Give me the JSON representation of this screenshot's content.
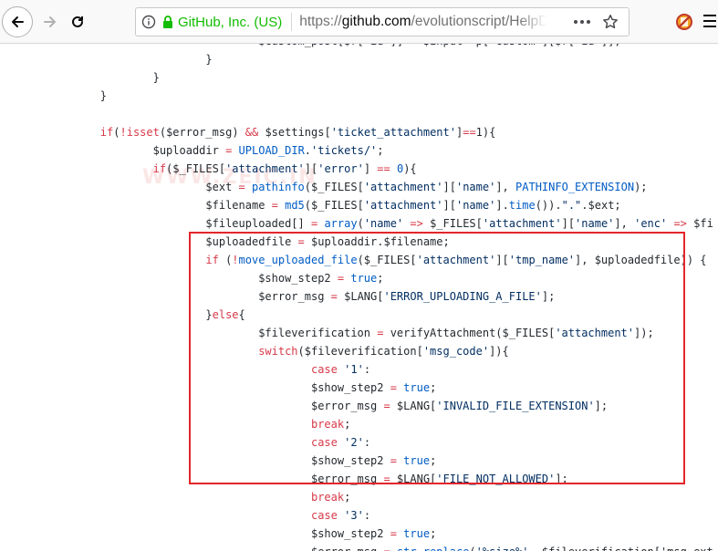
{
  "browser": {
    "identity_label": "GitHub, Inc. (US)",
    "url_prefix": "https://",
    "url_domain": "github.com",
    "url_path": "/evolutionscript/HelpDe",
    "icons": [
      "back-icon",
      "forward-icon",
      "reload-icon",
      "info-icon",
      "lock-icon",
      "page-actions-icon",
      "bookmark-star-icon",
      "addon-icon",
      "menu-icon"
    ]
  },
  "watermark": "WWW.ZEIC.IN",
  "code_lines": [
    [
      {
        "t": "                                "
      },
      {
        "t": "$custom_post[$r['id']] = $input->p['custom'][$r['id']];"
      }
    ],
    [
      {
        "t": "                        }"
      }
    ],
    [
      {
        "t": "                }"
      }
    ],
    [
      {
        "t": "        }"
      }
    ],
    [
      {
        "t": ""
      }
    ],
    [
      {
        "t": "        "
      },
      {
        "t": "if",
        "c": "k"
      },
      {
        "t": "("
      },
      {
        "t": "!",
        "c": "k"
      },
      {
        "t": "isset",
        "c": "k"
      },
      {
        "t": "($error_msg) "
      },
      {
        "t": "&&",
        "c": "k"
      },
      {
        "t": " $settings["
      },
      {
        "t": "'ticket_attachment'",
        "c": "s"
      },
      {
        "t": "]"
      },
      {
        "t": "==",
        "c": "k"
      },
      {
        "t": "1){"
      }
    ],
    [
      {
        "t": "                $uploaddir "
      },
      {
        "t": "=",
        "c": "k"
      },
      {
        "t": " "
      },
      {
        "t": "UPLOAD_DIR",
        "c": "f"
      },
      {
        "t": "."
      },
      {
        "t": "'tickets/'",
        "c": "s"
      },
      {
        "t": ";"
      }
    ],
    [
      {
        "t": "                "
      },
      {
        "t": "if",
        "c": "k"
      },
      {
        "t": "($_FILES["
      },
      {
        "t": "'attachment'",
        "c": "s"
      },
      {
        "t": "]["
      },
      {
        "t": "'error'",
        "c": "s"
      },
      {
        "t": "] "
      },
      {
        "t": "==",
        "c": "k"
      },
      {
        "t": " "
      },
      {
        "t": "0",
        "c": "f"
      },
      {
        "t": "){"
      }
    ],
    [
      {
        "t": "                        $ext "
      },
      {
        "t": "=",
        "c": "k"
      },
      {
        "t": " "
      },
      {
        "t": "pathinfo",
        "c": "f"
      },
      {
        "t": "($_FILES["
      },
      {
        "t": "'attachment'",
        "c": "s"
      },
      {
        "t": "]["
      },
      {
        "t": "'name'",
        "c": "s"
      },
      {
        "t": "], "
      },
      {
        "t": "PATHINFO_EXTENSION",
        "c": "f"
      },
      {
        "t": ");"
      }
    ],
    [
      {
        "t": "                        $filename "
      },
      {
        "t": "=",
        "c": "k"
      },
      {
        "t": " "
      },
      {
        "t": "md5",
        "c": "f"
      },
      {
        "t": "($_FILES["
      },
      {
        "t": "'attachment'",
        "c": "s"
      },
      {
        "t": "]["
      },
      {
        "t": "'name'",
        "c": "s"
      },
      {
        "t": "]."
      },
      {
        "t": "time",
        "c": "f"
      },
      {
        "t": "())."
      },
      {
        "t": "\".\"",
        "c": "s"
      },
      {
        "t": ".$ext;"
      }
    ],
    [
      {
        "t": "                        $fileuploaded[] "
      },
      {
        "t": "=",
        "c": "k"
      },
      {
        "t": " "
      },
      {
        "t": "array",
        "c": "f"
      },
      {
        "t": "("
      },
      {
        "t": "'name'",
        "c": "s"
      },
      {
        "t": " "
      },
      {
        "t": "=>",
        "c": "k"
      },
      {
        "t": " $_FILES["
      },
      {
        "t": "'attachment'",
        "c": "s"
      },
      {
        "t": "]["
      },
      {
        "t": "'name'",
        "c": "s"
      },
      {
        "t": "], "
      },
      {
        "t": "'enc'",
        "c": "s"
      },
      {
        "t": " "
      },
      {
        "t": "=>",
        "c": "k"
      },
      {
        "t": " $fi"
      }
    ],
    [
      {
        "t": "                        $uploadedfile "
      },
      {
        "t": "=",
        "c": "k"
      },
      {
        "t": " $uploaddir.$filename;"
      }
    ],
    [
      {
        "t": "                        "
      },
      {
        "t": "if",
        "c": "k"
      },
      {
        "t": " ("
      },
      {
        "t": "!",
        "c": "k"
      },
      {
        "t": "move_uploaded_file",
        "c": "f"
      },
      {
        "t": "($_FILES["
      },
      {
        "t": "'attachment'",
        "c": "s"
      },
      {
        "t": "]["
      },
      {
        "t": "'tmp_name'",
        "c": "s"
      },
      {
        "t": "], $uploadedfile)) {"
      }
    ],
    [
      {
        "t": "                                $show_step2 "
      },
      {
        "t": "=",
        "c": "k"
      },
      {
        "t": " "
      },
      {
        "t": "true",
        "c": "f"
      },
      {
        "t": ";"
      }
    ],
    [
      {
        "t": "                                $error_msg "
      },
      {
        "t": "=",
        "c": "k"
      },
      {
        "t": " $LANG["
      },
      {
        "t": "'ERROR_UPLOADING_A_FILE'",
        "c": "s"
      },
      {
        "t": "];"
      }
    ],
    [
      {
        "t": "                        }"
      },
      {
        "t": "else",
        "c": "k"
      },
      {
        "t": "{"
      }
    ],
    [
      {
        "t": "                                $fileverification "
      },
      {
        "t": "=",
        "c": "k"
      },
      {
        "t": " verifyAttachment($_FILES["
      },
      {
        "t": "'attachment'",
        "c": "s"
      },
      {
        "t": "]);"
      }
    ],
    [
      {
        "t": "                                "
      },
      {
        "t": "switch",
        "c": "k"
      },
      {
        "t": "($fileverification["
      },
      {
        "t": "'msg_code'",
        "c": "s"
      },
      {
        "t": "]){"
      }
    ],
    [
      {
        "t": "                                        "
      },
      {
        "t": "case",
        "c": "k"
      },
      {
        "t": " "
      },
      {
        "t": "'1'",
        "c": "s"
      },
      {
        "t": ":"
      }
    ],
    [
      {
        "t": "                                        $show_step2 "
      },
      {
        "t": "=",
        "c": "k"
      },
      {
        "t": " "
      },
      {
        "t": "true",
        "c": "f"
      },
      {
        "t": ";"
      }
    ],
    [
      {
        "t": "                                        $error_msg "
      },
      {
        "t": "=",
        "c": "k"
      },
      {
        "t": " $LANG["
      },
      {
        "t": "'INVALID_FILE_EXTENSION'",
        "c": "s"
      },
      {
        "t": "];"
      }
    ],
    [
      {
        "t": "                                        "
      },
      {
        "t": "break",
        "c": "k"
      },
      {
        "t": ";"
      }
    ],
    [
      {
        "t": "                                        "
      },
      {
        "t": "case",
        "c": "k"
      },
      {
        "t": " "
      },
      {
        "t": "'2'",
        "c": "s"
      },
      {
        "t": ":"
      }
    ],
    [
      {
        "t": "                                        $show_step2 "
      },
      {
        "t": "=",
        "c": "k"
      },
      {
        "t": " "
      },
      {
        "t": "true",
        "c": "f"
      },
      {
        "t": ";"
      }
    ],
    [
      {
        "t": "                                        $error_msg "
      },
      {
        "t": "=",
        "c": "k"
      },
      {
        "t": " $LANG["
      },
      {
        "t": "'FILE_NOT_ALLOWED'",
        "c": "s"
      },
      {
        "t": "];"
      }
    ],
    [
      {
        "t": "                                        "
      },
      {
        "t": "break",
        "c": "k"
      },
      {
        "t": ";"
      }
    ],
    [
      {
        "t": "                                        "
      },
      {
        "t": "case",
        "c": "k"
      },
      {
        "t": " "
      },
      {
        "t": "'3'",
        "c": "s"
      },
      {
        "t": ":"
      }
    ],
    [
      {
        "t": "                                        $show_step2 "
      },
      {
        "t": "=",
        "c": "k"
      },
      {
        "t": " "
      },
      {
        "t": "true",
        "c": "f"
      },
      {
        "t": ";"
      }
    ],
    [
      {
        "t": "                                        $error_msg "
      },
      {
        "t": "=",
        "c": "k"
      },
      {
        "t": " "
      },
      {
        "t": "str_replace",
        "c": "f"
      },
      {
        "t": "("
      },
      {
        "t": "'%size%'",
        "c": "s"
      },
      {
        "t": ", $fileverification['msg_ext"
      }
    ]
  ],
  "highlight_color": "#e3262b",
  "syntax_colors": {
    "keyword": "#d73a49",
    "function": "#005cc5",
    "string": "#032f62",
    "text": "#24292e"
  }
}
